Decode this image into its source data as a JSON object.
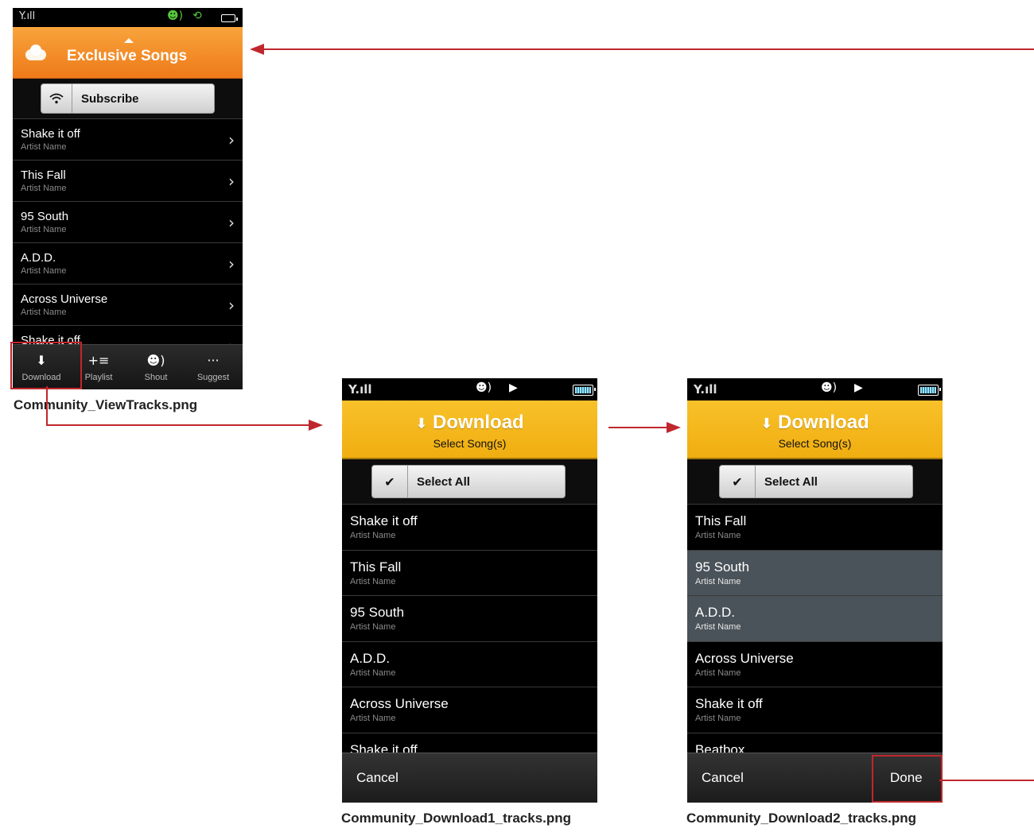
{
  "screens": {
    "view_tracks": {
      "header_title": "Exclusive Songs",
      "subscribe_label": "Subscribe",
      "tracks": [
        {
          "title": "Shake it off",
          "artist": "Artist Name"
        },
        {
          "title": "This Fall",
          "artist": "Artist Name"
        },
        {
          "title": "95 South",
          "artist": "Artist Name"
        },
        {
          "title": "A.D.D.",
          "artist": "Artist Name"
        },
        {
          "title": "Across Universe",
          "artist": "Artist Name"
        },
        {
          "title": "Shake it off",
          "artist": ""
        }
      ],
      "tabs": [
        {
          "label": "Download",
          "icon": "download-icon"
        },
        {
          "label": "Playlist",
          "icon": "playlist-add-icon"
        },
        {
          "label": "Shout",
          "icon": "shout-icon"
        },
        {
          "label": "Suggest",
          "icon": "more-icon"
        }
      ],
      "caption": "Community_ViewTracks.png"
    },
    "download1": {
      "header_title": "Download",
      "header_subtitle": "Select  Song(s)",
      "select_all_label": "Select All",
      "tracks": [
        {
          "title": "Shake it off",
          "artist": "Artist Name",
          "selected": false
        },
        {
          "title": "This Fall",
          "artist": "Artist Name",
          "selected": false
        },
        {
          "title": "95 South",
          "artist": "Artist Name",
          "selected": false
        },
        {
          "title": "A.D.D.",
          "artist": "Artist Name",
          "selected": false
        },
        {
          "title": "Across Universe",
          "artist": "Artist Name",
          "selected": false
        },
        {
          "title": "Shake it off",
          "artist": "",
          "selected": false
        }
      ],
      "cancel_label": "Cancel",
      "caption": "Community_Download1_tracks.png"
    },
    "download2": {
      "header_title": "Download",
      "header_subtitle": "Select  Song(s)",
      "select_all_label": "Select All",
      "tracks": [
        {
          "title": "This Fall",
          "artist": "Artist Name",
          "selected": false
        },
        {
          "title": "95 South",
          "artist": "Artist Name",
          "selected": true
        },
        {
          "title": "A.D.D.",
          "artist": "Artist Name",
          "selected": true
        },
        {
          "title": "Across Universe",
          "artist": "Artist Name",
          "selected": false
        },
        {
          "title": "Shake it off",
          "artist": "Artist Name",
          "selected": false
        },
        {
          "title": "Beatbox",
          "artist": "",
          "selected": false
        }
      ],
      "cancel_label": "Cancel",
      "done_label": "Done",
      "caption": "Community_Download2_tracks.png"
    }
  },
  "colors": {
    "header_orange": "#ef7d1c",
    "header_yellow": "#f3b516",
    "annotation_red": "#c0272d",
    "selected_row": "#4a535a"
  }
}
